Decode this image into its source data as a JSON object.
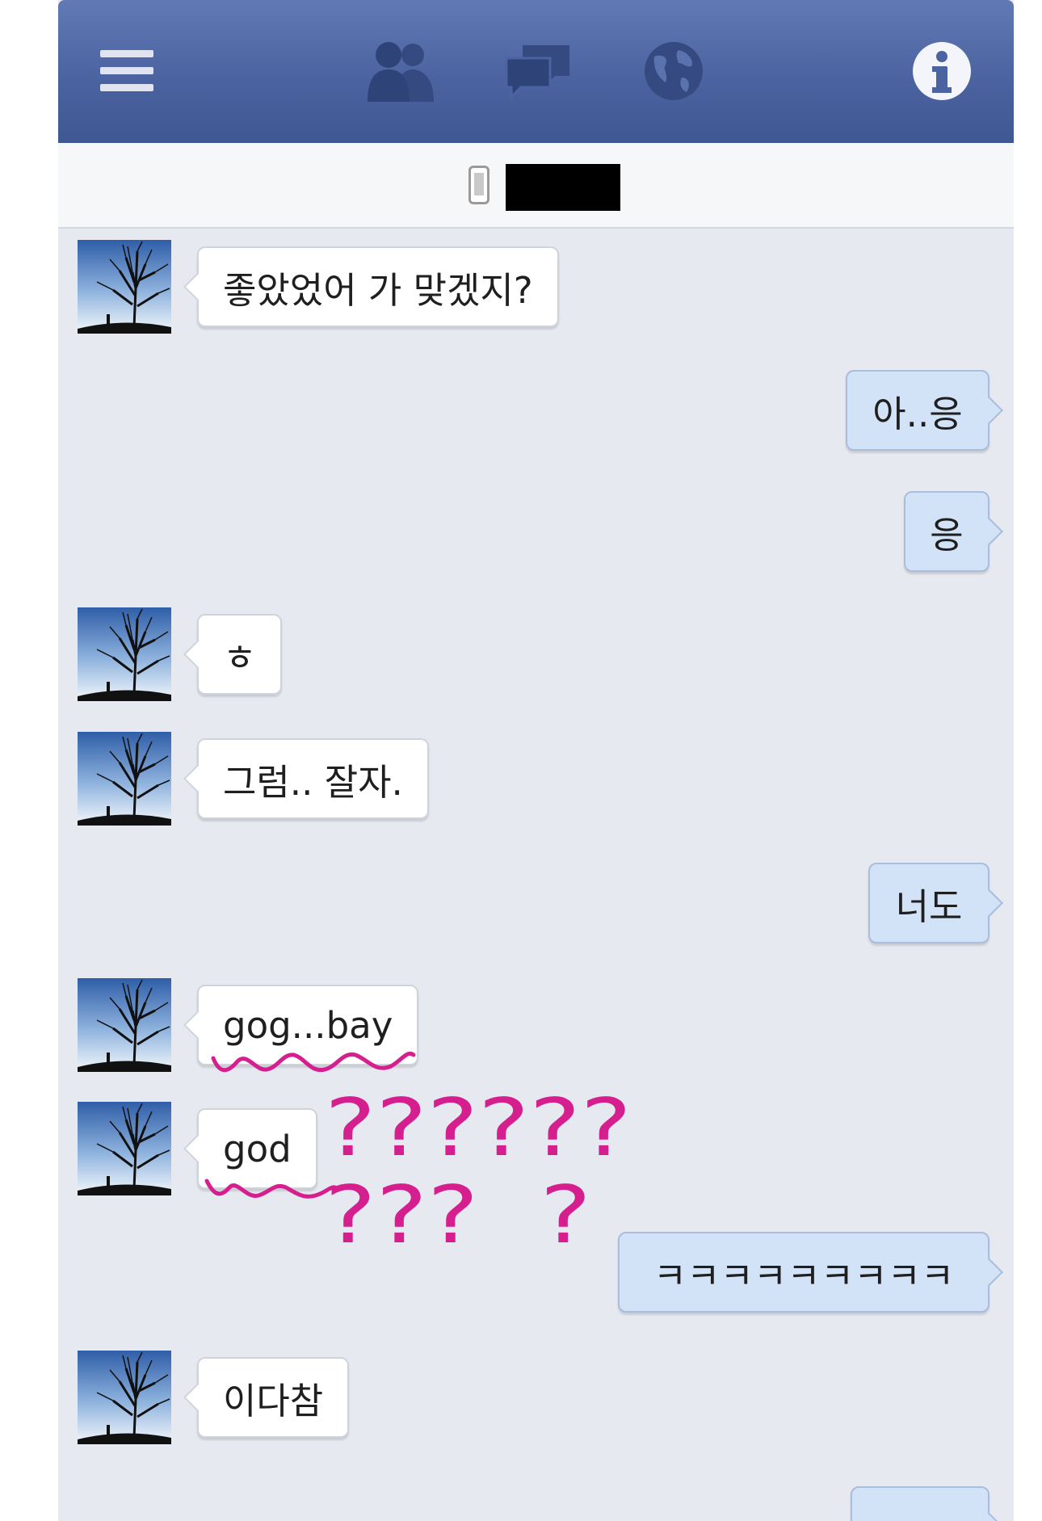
{
  "topbar": {
    "icons": [
      "menu-icon",
      "friends-icon",
      "messages-icon",
      "globe-icon",
      "info-icon"
    ],
    "color": "#4b63a0"
  },
  "conversation": {
    "device": "mobile-phone-icon"
  },
  "messages": [
    {
      "side": "in",
      "text": "좋았었어 가 맞겠지?"
    },
    {
      "side": "out",
      "text": "아..응"
    },
    {
      "side": "out",
      "text": "응"
    },
    {
      "side": "in",
      "text": "ㅎ"
    },
    {
      "side": "in",
      "text": "그럼.. 잘자."
    },
    {
      "side": "out",
      "text": "너도"
    },
    {
      "side": "in",
      "text": "gog...bay"
    },
    {
      "side": "in",
      "text": "god"
    },
    {
      "side": "out",
      "text": "ㅋㅋㅋㅋㅋㅋㅋㅋㅋ"
    },
    {
      "side": "in",
      "text": "이다참"
    }
  ],
  "annotation": {
    "line1": "??????",
    "line2": "???  ?",
    "color": "#d61f8e"
  }
}
